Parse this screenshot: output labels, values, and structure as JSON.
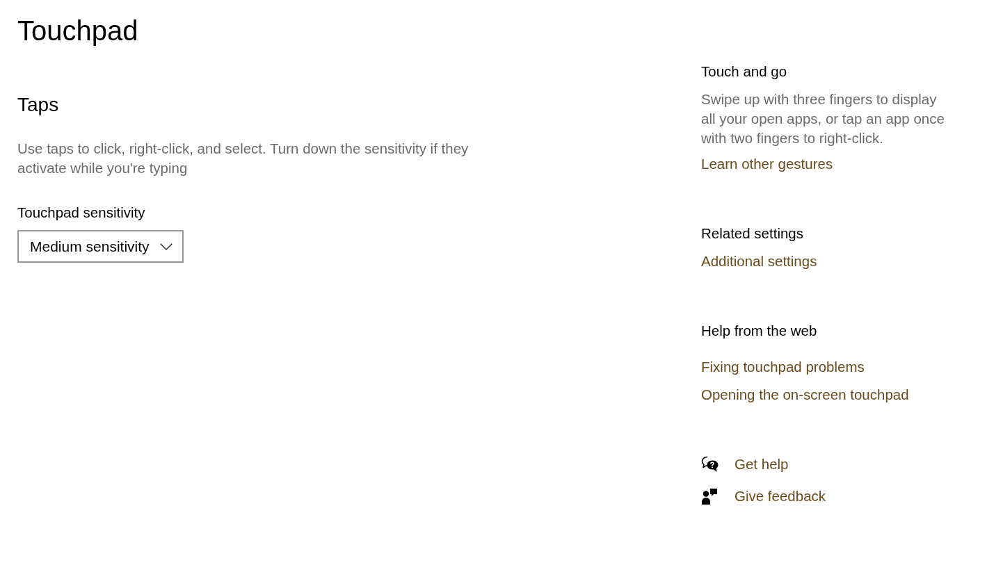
{
  "page": {
    "title": "Touchpad"
  },
  "taps": {
    "heading": "Taps",
    "description": "Use taps to click, right-click, and select. Turn down the sensitivity if they activate while you're typing",
    "sensitivity": {
      "label": "Touchpad sensitivity",
      "value": "Medium sensitivity"
    }
  },
  "sidebar": {
    "sections": [
      {
        "heading": "Touch and go",
        "description": "Swipe up with three fingers to display all your open apps, or tap an app once with two fingers to right-click.",
        "links": [
          "Learn other gestures"
        ]
      },
      {
        "heading": "Related settings",
        "links": [
          "Additional settings"
        ]
      },
      {
        "heading": "Help from the web",
        "links": [
          "Fixing touchpad problems",
          "Opening the on-screen touchpad"
        ]
      }
    ],
    "actions": [
      {
        "kind": "help",
        "label": "Get help"
      },
      {
        "kind": "feedback",
        "label": "Give feedback"
      }
    ]
  }
}
